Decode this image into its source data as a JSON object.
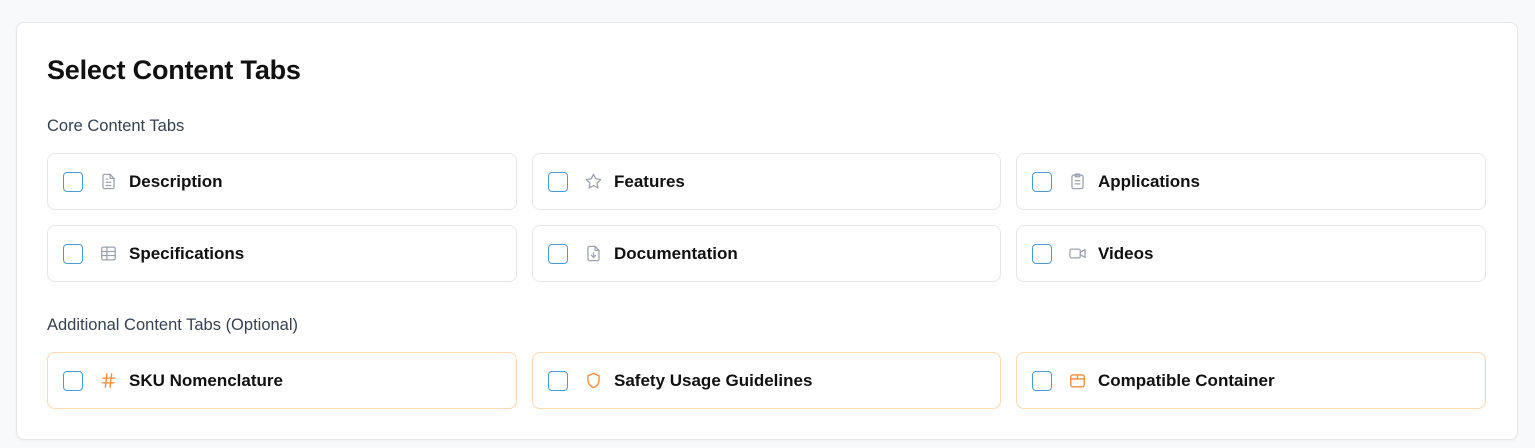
{
  "title": "Select Content Tabs",
  "core_section": {
    "label": "Core Content Tabs",
    "items": [
      {
        "label": "Description",
        "icon": "document-icon",
        "checked": false
      },
      {
        "label": "Features",
        "icon": "star-icon",
        "checked": false
      },
      {
        "label": "Applications",
        "icon": "clipboard-icon",
        "checked": false
      },
      {
        "label": "Specifications",
        "icon": "table-icon",
        "checked": false
      },
      {
        "label": "Documentation",
        "icon": "file-download-icon",
        "checked": false
      },
      {
        "label": "Videos",
        "icon": "video-icon",
        "checked": false
      }
    ]
  },
  "additional_section": {
    "label": "Additional Content Tabs (Optional)",
    "items": [
      {
        "label": "SKU Nomenclature",
        "icon": "hash-icon",
        "checked": false
      },
      {
        "label": "Safety Usage Guidelines",
        "icon": "shield-icon",
        "checked": false
      },
      {
        "label": "Compatible Container",
        "icon": "box-icon",
        "checked": false
      }
    ]
  },
  "colors": {
    "checkbox_border": "#4b9bd6",
    "core_icon": "#9ca3af",
    "optional_icon": "#f28c38",
    "optional_border": "#fcd9b0"
  }
}
